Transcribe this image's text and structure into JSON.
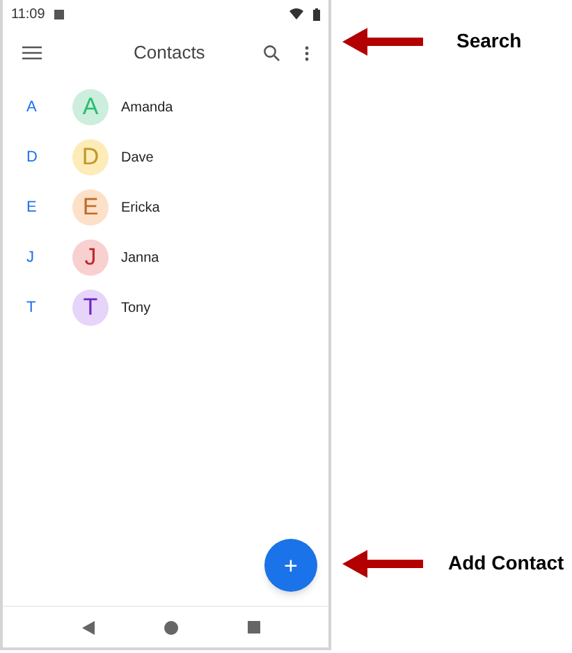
{
  "status_bar": {
    "time": "11:09"
  },
  "toolbar": {
    "title": "Contacts"
  },
  "contacts": [
    {
      "section": "A",
      "initial": "A",
      "name": "Amanda",
      "color": "#cdeedd"
    },
    {
      "section": "D",
      "initial": "D",
      "name": "Dave",
      "color": "#fdecb8"
    },
    {
      "section": "E",
      "initial": "E",
      "name": "Ericka",
      "color": "#fde0c8"
    },
    {
      "section": "J",
      "initial": "J",
      "name": "Janna",
      "color": "#f8d0d0"
    },
    {
      "section": "T",
      "initial": "T",
      "name": "Tony",
      "color": "#e6d4fb"
    }
  ],
  "fab": {
    "label": "+"
  },
  "callouts": [
    "Search",
    "Add Contact"
  ]
}
